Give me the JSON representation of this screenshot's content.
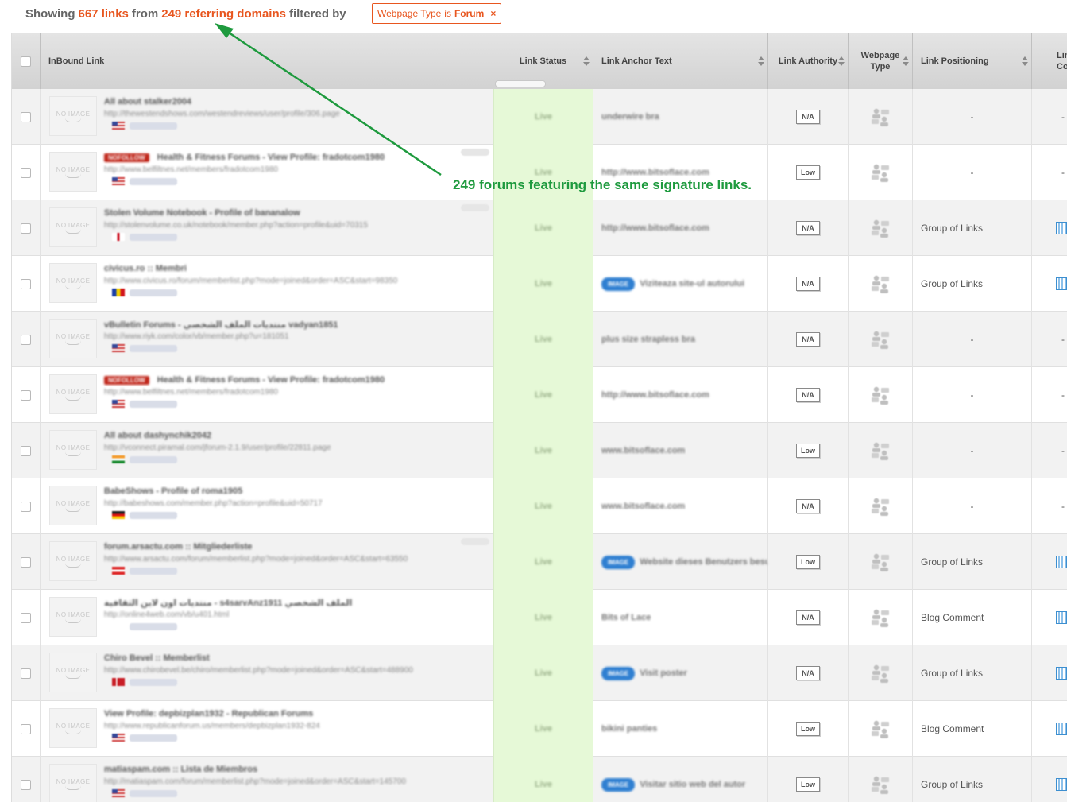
{
  "summary": {
    "prefix": "Showing",
    "links": "667 links",
    "from": "from",
    "domains": "249 referring domains",
    "filtered": "filtered by"
  },
  "filter": {
    "field": "Webpage Type",
    "op": "is",
    "value": "Forum",
    "remove": "×"
  },
  "annotation": "249 forums featuring the same signature links.",
  "columns": {
    "inbound": "InBound Link",
    "status": "Link Status",
    "anchor": "Link Anchor Text",
    "authority": "Link Authority",
    "type_line1": "Webpage",
    "type_line2": "Type",
    "positioning": "Link Positioning",
    "content_line1": "Lin",
    "content_line2": "Conte"
  },
  "no_image": "NO IMAGE",
  "rows": [
    {
      "title": "All about stalker2004",
      "url": "http://thewestendshows.com/westendreviews/user/profile/306.page",
      "nofollow": false,
      "flag": "us",
      "status": "Live",
      "anchor": "underwire bra",
      "image_anchor": false,
      "authority": "N/A",
      "positioning": "-",
      "content": "-"
    },
    {
      "title": "Health & Fitness Forums - View Profile: fradotcom1980",
      "url": "http://www.belfiltnes.net/members/fradotcom1980",
      "nofollow": true,
      "flag": "us",
      "status": "Live",
      "anchor": "http://www.bitsoflace.com",
      "image_anchor": false,
      "authority": "Low",
      "positioning": "-",
      "content": "-"
    },
    {
      "title": "Stolen Volume Notebook - Profile of bananalow",
      "url": "http://stolenvolume.co.uk/notebook/member.php?action=profile&uid=70315",
      "nofollow": false,
      "flag": "uk",
      "status": "Live",
      "anchor": "http://www.bitsoflace.com",
      "image_anchor": false,
      "authority": "N/A",
      "positioning": "Group of Links",
      "content": "icon"
    },
    {
      "title": "civicus.ro :: Membri",
      "url": "http://www.civicus.ro/forum/memberlist.php?mode=joined&order=ASC&start=98350",
      "nofollow": false,
      "flag": "ro",
      "status": "Live",
      "anchor": "Viziteaza site-ul autorului",
      "image_anchor": true,
      "authority": "N/A",
      "positioning": "Group of Links",
      "content": "icon"
    },
    {
      "title": "vBulletin Forums - منتديات الملف الشخصي vadyan1851",
      "url": "http://www.riyk.com/color/vb/member.php?u=181051",
      "nofollow": false,
      "flag": "us",
      "status": "Live",
      "anchor": "plus size strapless bra",
      "image_anchor": false,
      "authority": "N/A",
      "positioning": "-",
      "content": "-"
    },
    {
      "title": "Health & Fitness Forums - View Profile: fradotcom1980",
      "url": "http://www.belfiltnes.net/members/fradotcom1980",
      "nofollow": true,
      "flag": "us",
      "status": "Live",
      "anchor": "http://www.bitsoflace.com",
      "image_anchor": false,
      "authority": "N/A",
      "positioning": "-",
      "content": "-"
    },
    {
      "title": "All about dashynchik2042",
      "url": "http://vconnect.piramal.com/jforum-2.1.9/user/profile/22811.page",
      "nofollow": false,
      "flag": "in",
      "status": "Live",
      "anchor": "www.bitsoflace.com",
      "image_anchor": false,
      "authority": "Low",
      "positioning": "-",
      "content": "-"
    },
    {
      "title": "BabeShows - Profile of roma1905",
      "url": "http://babeshows.com/member.php?action=profile&uid=50717",
      "nofollow": false,
      "flag": "de",
      "status": "Live",
      "anchor": "www.bitsoflace.com",
      "image_anchor": false,
      "authority": "N/A",
      "positioning": "-",
      "content": "-"
    },
    {
      "title": "forum.arsactu.com :: Mitgliederliste",
      "url": "http://www.arsactu.com/forum/memberlist.php?mode=joined&order=ASC&start=63550",
      "nofollow": false,
      "flag": "at",
      "status": "Live",
      "anchor": "Website dieses Benutzers besuchen",
      "image_anchor": true,
      "authority": "Low",
      "positioning": "Group of Links",
      "content": "icon"
    },
    {
      "title": "منتديات اون لاين الثقافية - s4sarvAnz1911 الملف الشخصي",
      "url": "http://online4web.com/vb/u401.html",
      "nofollow": false,
      "flag": "none",
      "status": "Live",
      "anchor": "Bits of Lace",
      "image_anchor": false,
      "authority": "N/A",
      "positioning": "Blog Comment",
      "content": "icon"
    },
    {
      "title": "Chiro Bevel :: Memberlist",
      "url": "http://www.chirobevel.be/chiro/memberlist.php?mode=joined&order=ASC&start=488900",
      "nofollow": false,
      "flag": "dk",
      "status": "Live",
      "anchor": "Visit poster",
      "image_anchor": true,
      "authority": "N/A",
      "positioning": "Group of Links",
      "content": "icon"
    },
    {
      "title": "View Profile: depbizplan1932 - Republican Forums",
      "url": "http://www.republicanforum.us/members/depbizplan1932-824",
      "nofollow": false,
      "flag": "us",
      "status": "Live",
      "anchor": "bikini panties",
      "image_anchor": false,
      "authority": "Low",
      "positioning": "Blog Comment",
      "content": "icon"
    },
    {
      "title": "matiaspam.com :: Lista de Miembros",
      "url": "http://matiaspam.com/forum/memberlist.php?mode=joined&order=ASC&start=145700",
      "nofollow": false,
      "flag": "us",
      "status": "Live",
      "anchor": "Visitar sitio web del autor",
      "image_anchor": true,
      "authority": "Low",
      "positioning": "Group of Links",
      "content": "icon"
    }
  ],
  "colors": {
    "accent": "#e8561f",
    "annotation": "#1e9a3e",
    "status_bg": "#e6f9d7",
    "nofollow": "#c0261a",
    "image_badge": "#2f7fd1"
  },
  "icons": {
    "webpage_type": "forum-users-icon",
    "content": "content-grid-icon"
  }
}
